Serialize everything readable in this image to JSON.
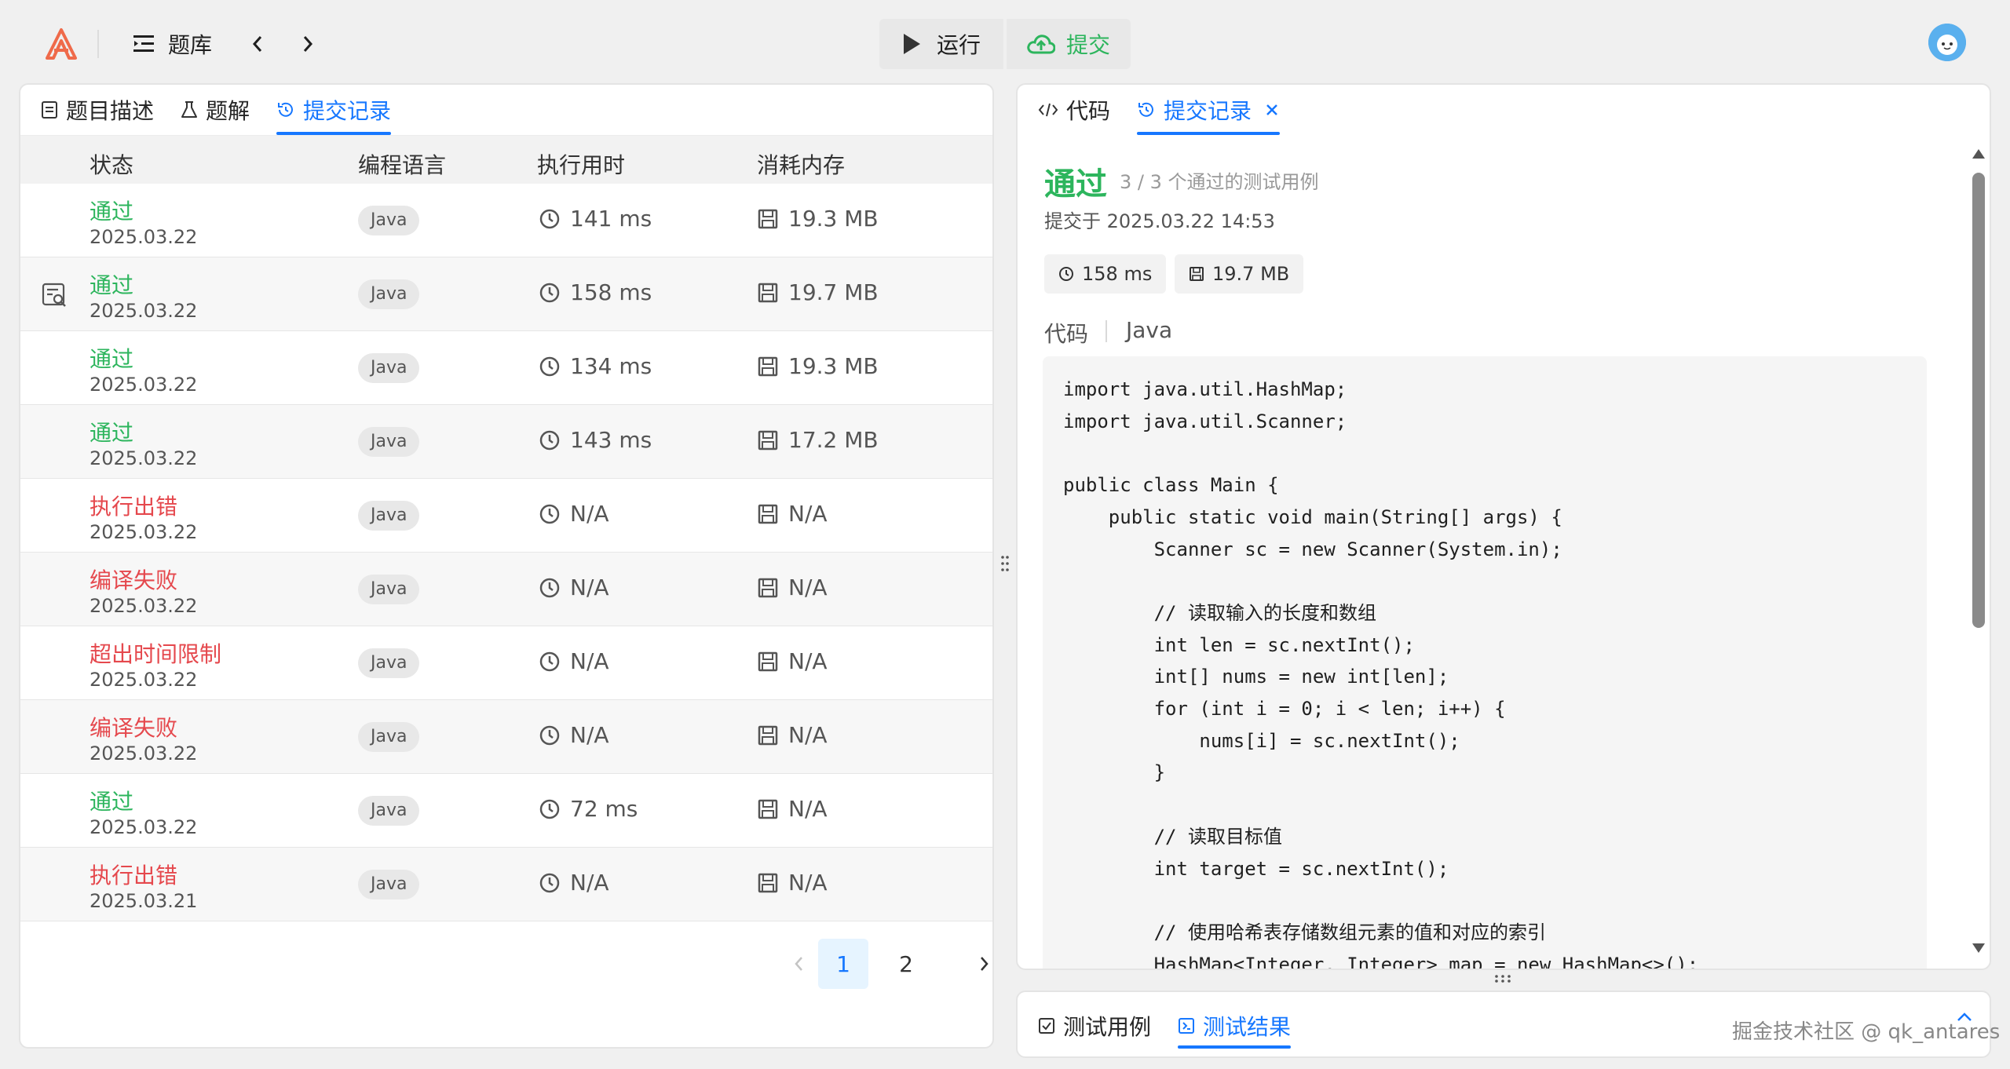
{
  "colors": {
    "accent": "#1677ff",
    "success": "#2db55d",
    "error": "#e5484d",
    "logo": "#ef6a4a"
  },
  "header": {
    "problem_bank_label": "题库",
    "run_label": "运行",
    "submit_label": "提交"
  },
  "left_tabs": [
    {
      "label": "题目描述",
      "icon": "document-icon"
    },
    {
      "label": "题解",
      "icon": "flask-icon"
    },
    {
      "label": "提交记录",
      "icon": "history-icon"
    }
  ],
  "table": {
    "columns": [
      "状态",
      "编程语言",
      "执行用时",
      "消耗内存"
    ],
    "rows": [
      {
        "status": "通过",
        "date": "2025.03.22",
        "language": "Java",
        "time": "141 ms",
        "memory": "19.3 MB"
      },
      {
        "status": "通过",
        "date": "2025.03.22",
        "language": "Java",
        "time": "158 ms",
        "memory": "19.7 MB"
      },
      {
        "status": "通过",
        "date": "2025.03.22",
        "language": "Java",
        "time": "134 ms",
        "memory": "19.3 MB"
      },
      {
        "status": "通过",
        "date": "2025.03.22",
        "language": "Java",
        "time": "143 ms",
        "memory": "17.2 MB"
      },
      {
        "status": "执行出错",
        "date": "2025.03.22",
        "language": "Java",
        "time": "N/A",
        "memory": "N/A"
      },
      {
        "status": "编译失败",
        "date": "2025.03.22",
        "language": "Java",
        "time": "N/A",
        "memory": "N/A"
      },
      {
        "status": "超出时间限制",
        "date": "2025.03.22",
        "language": "Java",
        "time": "N/A",
        "memory": "N/A"
      },
      {
        "status": "编译失败",
        "date": "2025.03.22",
        "language": "Java",
        "time": "N/A",
        "memory": "N/A"
      },
      {
        "status": "通过",
        "date": "2025.03.22",
        "language": "Java",
        "time": "72 ms",
        "memory": "N/A"
      },
      {
        "status": "执行出错",
        "date": "2025.03.21",
        "language": "Java",
        "time": "N/A",
        "memory": "N/A"
      }
    ]
  },
  "pagination": {
    "pages": [
      "1",
      "2"
    ],
    "current": "1"
  },
  "right_tabs": [
    {
      "label": "代码",
      "icon": "code-icon"
    },
    {
      "label": "提交记录",
      "icon": "history-icon"
    }
  ],
  "detail": {
    "result": "通过",
    "cases": "3 / 3 个通过的测试用例",
    "submitted_at": "提交于 2025.03.22 14:53",
    "time": "158 ms",
    "memory": "19.7 MB",
    "code_label": "代码",
    "code_language": "Java",
    "code": "import java.util.HashMap;\nimport java.util.Scanner;\n\npublic class Main {\n    public static void main(String[] args) {\n        Scanner sc = new Scanner(System.in);\n\n        // 读取输入的长度和数组\n        int len = sc.nextInt();\n        int[] nums = new int[len];\n        for (int i = 0; i < len; i++) {\n            nums[i] = sc.nextInt();\n        }\n\n        // 读取目标值\n        int target = sc.nextInt();\n\n        // 使用哈希表存储数组元素的值和对应的索引\n        HashMap<Integer, Integer> map = new HashMap<>();"
  },
  "bottom_tabs": [
    {
      "label": "测试用例",
      "icon": "checkbox-icon"
    },
    {
      "label": "测试结果",
      "icon": "terminal-icon"
    }
  ],
  "watermark": "掘金技术社区 @ qk_antares"
}
